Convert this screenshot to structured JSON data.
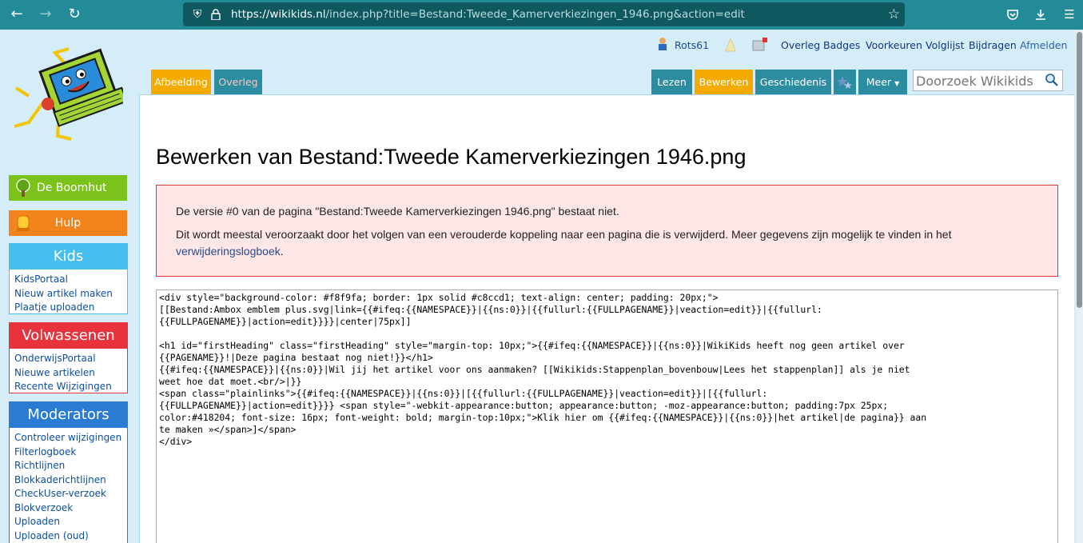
{
  "browser": {
    "url_host": "https://wikikids.nl",
    "url_rest": "/index.php?title=Bestand:Tweede_Kamerverkiezingen_1946.png&action=edit"
  },
  "user": {
    "name": "Rots61"
  },
  "personal_links": [
    "Overleg",
    "Badges",
    "Voorkeuren",
    "Volglijst",
    "Bijdragen",
    "Afmelden"
  ],
  "tabs_left": [
    "Afbeelding",
    "Overleg"
  ],
  "tabs_right": [
    "Lezen",
    "Bewerken",
    "Geschiedenis",
    "Meer"
  ],
  "search": {
    "placeholder": "Doorzoek Wikikids"
  },
  "sidebar": {
    "boomhut": "De Boomhut",
    "hulp": "Hulp",
    "kids": {
      "title": "Kids",
      "items": [
        "KidsPortaal",
        "Nieuw artikel maken",
        "Plaatje uploaden"
      ]
    },
    "volwassenen": {
      "title": "Volwassenen",
      "items": [
        "OnderwijsPortaal",
        "Nieuwe artikelen",
        "Recente Wijzigingen"
      ]
    },
    "moderators": {
      "title": "Moderators",
      "items": [
        "Controleer wijzigingen",
        "Filterlogboek",
        "Richtlijnen",
        "Blokkaderichtlijnen",
        "CheckUser-verzoek",
        "Blokverzoek",
        "Uploaden",
        "Uploaden (oud)"
      ]
    }
  },
  "page": {
    "heading": "Bewerken van Bestand:Tweede Kamerverkiezingen 1946.png",
    "error_line1": "De versie #0 van de pagina \"Bestand:Tweede Kamerverkiezingen 1946.png\" bestaat niet.",
    "error_line2": "Dit wordt meestal veroorzaakt door het volgen van een verouderde koppeling naar een pagina die is verwijderd. Meer gegevens zijn mogelijk te vinden in het",
    "error_link": "verwijderingslogboek",
    "editor_text": "<div style=\"background-color: #f8f9fa; border: 1px solid #c8ccd1; text-align: center; padding: 20px;\">\n[[Bestand:Ambox emblem plus.svg|link={{#ifeq:{{NAMESPACE}}|{{ns:0}}|{{fullurl:{{FULLPAGENAME}}|veaction=edit}}|{{fullurl:\n{{FULLPAGENAME}}|action=edit}}}}|center|75px]]\n\n<h1 id=\"firstHeading\" class=\"firstHeading\" style=\"margin-top: 10px;\">{{#ifeq:{{NAMESPACE}}|{{ns:0}}|WikiKids heeft nog geen artikel over\n{{PAGENAME}}!|Deze pagina bestaat nog niet!}}</h1>\n{{#ifeq:{{NAMESPACE}}|{{ns:0}}|Wil jij het artikel voor ons aanmaken? [[Wikikids:Stappenplan_bovenbouw|Lees het stappenplan]] als je niet\nweet hoe dat moet.<br/>|}}\n<span class=\"plainlinks\">{{#ifeq:{{NAMESPACE}}|{{ns:0}}|[{{fullurl:{{FULLPAGENAME}}|veaction=edit}}|[{{fullurl:\n{{FULLPAGENAME}}|action=edit}}}} <span style=\"-webkit-appearance:button; appearance:button; -moz-appearance:button; padding:7px 25px;\ncolor:#418204; font-size: 16px; font-weight: bold; margin-top:10px;\">Klik hier om {{#ifeq:{{NAMESPACE}}|{{ns:0}}|het artikel|de pagina}} aan\nte maken »</span>]</span>\n</div>"
  }
}
